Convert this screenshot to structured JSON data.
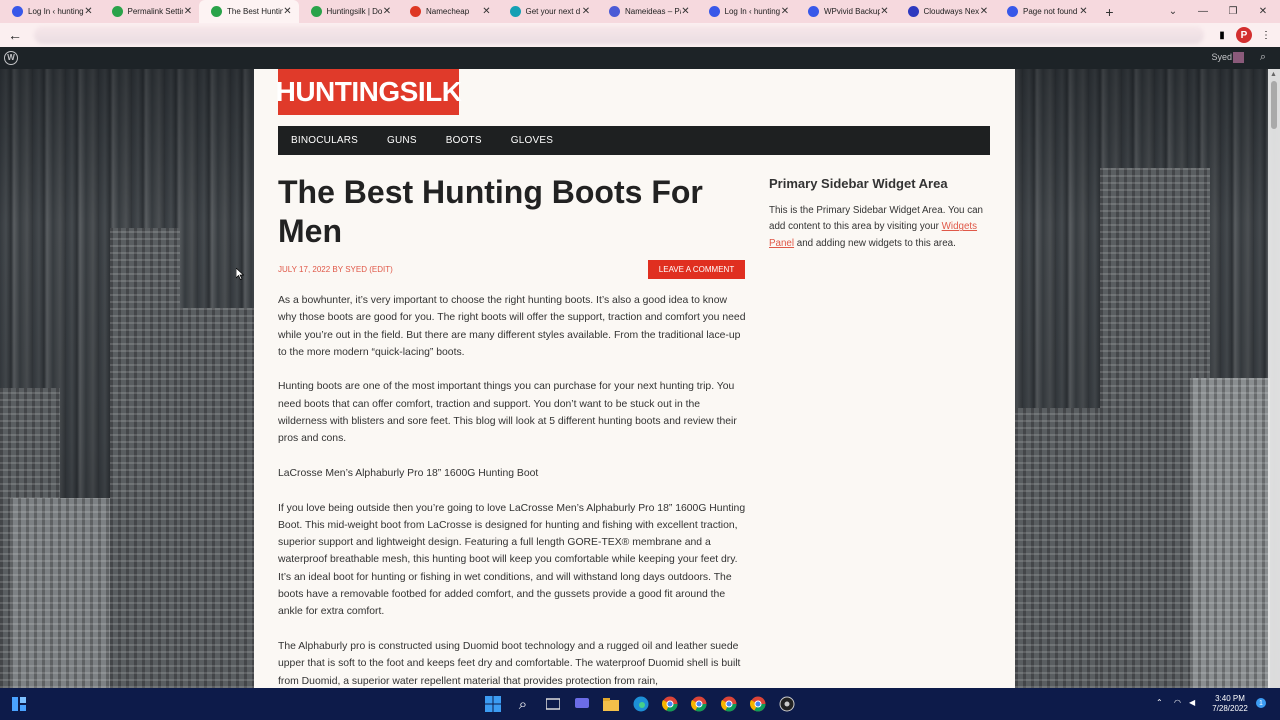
{
  "browser": {
    "tabs": [
      {
        "title": "Log In ‹ huntingsi",
        "favicon": "wordpress-icon",
        "color": "#3858e9"
      },
      {
        "title": "Permalink Settings",
        "favicon": "leaf-icon",
        "color": "#2aa34a"
      },
      {
        "title": "The Best Hunting B",
        "favicon": "leaf-icon",
        "color": "#2aa34a"
      },
      {
        "title": "Huntingsilk | Doc",
        "favicon": "leaf-icon",
        "color": "#2aa34a"
      },
      {
        "title": "Namecheap",
        "favicon": "namecheap-icon",
        "color": "#de3723"
      },
      {
        "title": "Get your next d",
        "favicon": "globe-icon",
        "color": "#14a0b4"
      },
      {
        "title": "Nameideas – Pa",
        "favicon": "nameideas-icon",
        "color": "#4b5bd6"
      },
      {
        "title": "Log In ‹ huntingsi",
        "favicon": "wordpress-icon",
        "color": "#3858e9"
      },
      {
        "title": "WPvivid Backup",
        "favicon": "wordpress-icon",
        "color": "#3858e9"
      },
      {
        "title": "Cloudways Next",
        "favicon": "cloud-icon",
        "color": "#2e39bf"
      },
      {
        "title": "Page not found",
        "favicon": "wordpress-icon",
        "color": "#3858e9"
      }
    ],
    "active_tab": 2,
    "profile_initial": "P"
  },
  "adminbar": {
    "howdy": "Syed"
  },
  "site": {
    "logo": "HUNTINGSILK",
    "nav": [
      "BINOCULARS",
      "GUNS",
      "BOOTS",
      "GLOVES"
    ]
  },
  "post": {
    "title": "The Best Hunting Boots For Men",
    "date": "JULY 17, 2022",
    "by": "BY",
    "author": "SYED",
    "edit": "(EDIT)",
    "comment_button": "LEAVE A COMMENT",
    "paragraphs": [
      "As a bowhunter, it’s very important to choose the right hunting boots. It’s also a good idea to know why those boots are good for you. The right boots will offer the support, traction and comfort you need while you’re out in the field. But there are many different styles available. From the traditional lace-up to the more modern “quick-lacing” boots.",
      "Hunting boots are one of the most important things you can purchase for your next hunting trip. You need boots that can offer comfort, traction and support. You don’t want to be stuck out in the wilderness with blisters and sore feet. This blog will look at 5 different hunting boots and review their pros and cons.",
      "LaCrosse Men’s Alphaburly Pro 18” 1600G Hunting Boot",
      "If you love being outside then you’re going to love LaCrosse Men’s Alphaburly Pro 18” 1600G Hunting Boot. This mid-weight boot from LaCrosse is designed for hunting and fishing with excellent traction, superior support and lightweight design. Featuring a full length GORE-TEX® membrane and a waterproof breathable mesh, this hunting boot will keep you comfortable while keeping your feet dry. It’s an ideal boot for hunting or fishing in wet conditions, and will withstand long days outdoors. The boots have a removable footbed for added comfort, and the gussets provide a good fit around the ankle for extra comfort.",
      "The Alphaburly pro is constructed using Duomid boot technology and a rugged oil and leather suede upper that is soft to the foot and keeps feet dry and comfortable. The waterproof Duomid shell is built from Duomid, a superior water repellent material that provides protection from rain,"
    ]
  },
  "sidebar": {
    "title": "Primary Sidebar Widget Area",
    "text_before": "This is the Primary Sidebar Widget Area. You can add content to this area by visiting your ",
    "link": "Widgets Panel",
    "text_after": " and adding new widgets to this area."
  },
  "taskbar": {
    "time": "3:40 PM",
    "date": "7/28/2022"
  },
  "colors": {
    "brand_red": "#e03a2a",
    "nav_bg": "#1e2021",
    "meta_red": "#e05848"
  }
}
